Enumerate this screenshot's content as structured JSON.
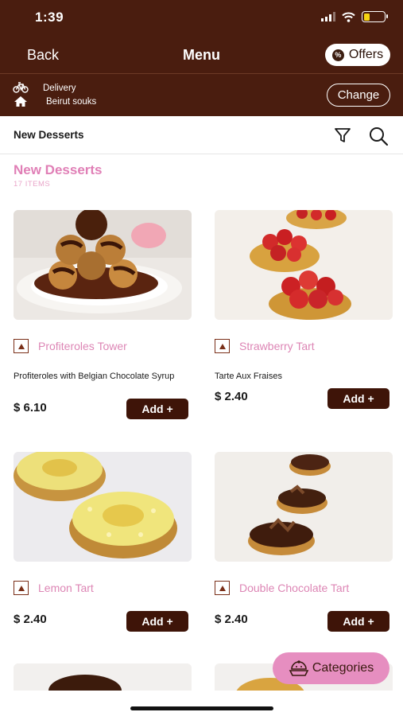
{
  "status_bar": {
    "time": "1:39"
  },
  "header": {
    "back_label": "Back",
    "title": "Menu",
    "offers_label": "Offers"
  },
  "delivery": {
    "mode": "Delivery",
    "location": "Beirut souks",
    "change_label": "Change"
  },
  "category_bar": {
    "name": "New Desserts"
  },
  "section": {
    "title": "New Desserts",
    "count": "17 ITEMS"
  },
  "products": [
    {
      "name": "Profiteroles Tower",
      "description": "Profiteroles with Belgian Chocolate Syrup",
      "price": "$ 6.10",
      "add_label": "Add +"
    },
    {
      "name": "Strawberry Tart",
      "description": "Tarte Aux Fraises",
      "price": "$ 2.40",
      "add_label": "Add +"
    },
    {
      "name": "Lemon Tart",
      "description": "",
      "price": "$ 2.40",
      "add_label": "Add +"
    },
    {
      "name": "Double Chocolate Tart",
      "description": "",
      "price": "$ 2.40",
      "add_label": "Add +"
    }
  ],
  "categories_button": {
    "label": "Categories"
  },
  "colors": {
    "brand": "#4a1d0f",
    "accent_pink": "#e07fb6",
    "button": "#3e1408",
    "categories_pill": "#e68ec0"
  },
  "icons": [
    "bike-icon",
    "home-icon",
    "filter-icon",
    "search-icon",
    "offers-badge-icon",
    "veg-indicator-icon",
    "categories-icon"
  ]
}
